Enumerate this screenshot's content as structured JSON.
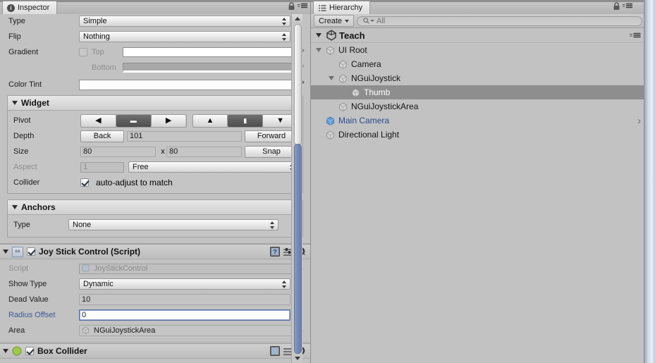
{
  "inspector": {
    "tab_label": "Inspector",
    "tab_icon": "info-icon",
    "lock_icon": "lock-icon",
    "menu_icon": "hamburger-menu-icon",
    "sprite_rows": [
      {
        "label": "Type",
        "value": "Simple",
        "kind": "popup"
      },
      {
        "label": "Flip",
        "value": "Nothing",
        "kind": "popup"
      }
    ],
    "gradient": {
      "label": "Gradient",
      "top_label": "Top",
      "bottom_label": "Bottom",
      "checked": false,
      "top_color": "#ffffff",
      "bottom_color": "#a8a8a8",
      "eyedropper_icon": "eyedropper-icon"
    },
    "color_tint": {
      "label": "Color Tint",
      "color": "#ffffff"
    },
    "widget": {
      "title": "Widget",
      "expanded": true,
      "pivot": {
        "label": "Pivot",
        "h_buttons": [
          "◀",
          "▬",
          "▶"
        ],
        "h_selected": 1,
        "v_buttons": [
          "▲",
          "▮",
          "▼"
        ],
        "v_selected": 1
      },
      "depth": {
        "label": "Depth",
        "back": "Back",
        "value": "101",
        "forward": "Forward"
      },
      "size": {
        "label": "Size",
        "width": "80",
        "sep": "x",
        "height": "80",
        "snap": "Snap"
      },
      "aspect": {
        "label": "Aspect",
        "value": "1",
        "mode": "Free",
        "disabled": true
      },
      "collider": {
        "label": "Collider",
        "checked": true,
        "text": "auto-adjust to match"
      }
    },
    "anchors": {
      "title": "Anchors",
      "expanded": true,
      "type": {
        "label": "Type",
        "value": "None"
      }
    },
    "joystick": {
      "title": "Joy Stick Control (Script)",
      "enabled": true,
      "expanded": true,
      "icon": "script-icon",
      "help_icon": "help-icon",
      "preset_icon": "preset-icon",
      "gear_icon": "gear-icon",
      "rows": [
        {
          "label": "Script",
          "value": "JoyStickControl",
          "kind": "object",
          "disabled": true,
          "icon": "script-ref-icon"
        },
        {
          "label": "Show Type",
          "value": "Dynamic",
          "kind": "popup"
        },
        {
          "label": "Dead Value",
          "value": "10",
          "kind": "text"
        },
        {
          "label": "Radius Offset",
          "value": "0",
          "kind": "text",
          "focused": true,
          "label_blue": true
        },
        {
          "label": "Area",
          "value": "NGuiJoystickArea",
          "kind": "object",
          "icon": "gameobject-icon"
        }
      ]
    },
    "next_component": {
      "title": "Box Collider",
      "checked": true,
      "icon": "collider-icon"
    }
  },
  "hierarchy": {
    "tab_label": "Hierarchy",
    "tab_icon": "hierarchy-icon",
    "lock_icon": "lock-icon",
    "menu_icon": "hamburger-menu-icon",
    "toolbar": {
      "create_label": "Create",
      "create_dropdown_icon": "chevron-down-icon",
      "search_icon": "search-icon",
      "search_value": "All",
      "search_placeholder": "All"
    },
    "scene_row": {
      "label": "Teach",
      "icon": "unity-scene-icon",
      "expanded": true,
      "menu_icon": "scene-menu-icon"
    },
    "items": [
      {
        "label": "UI Root",
        "depth": 1,
        "expanded": true,
        "icon": "gameobject-icon",
        "selected": false,
        "blue": false
      },
      {
        "label": "Camera",
        "depth": 2,
        "expanded": null,
        "icon": "gameobject-icon",
        "selected": false,
        "blue": false
      },
      {
        "label": "NGuiJoystick",
        "depth": 2,
        "expanded": true,
        "icon": "gameobject-icon",
        "selected": false,
        "blue": false
      },
      {
        "label": "Thumb",
        "depth": 3,
        "expanded": null,
        "icon": "gameobject-icon",
        "selected": true,
        "blue": false
      },
      {
        "label": "NGuiJoystickArea",
        "depth": 2,
        "expanded": null,
        "icon": "gameobject-icon",
        "selected": false,
        "blue": false
      },
      {
        "label": "Main Camera",
        "depth": 1,
        "expanded": null,
        "icon": "prefab-gameobject-icon",
        "selected": false,
        "blue": true,
        "chevron": "›"
      },
      {
        "label": "Directional Light",
        "depth": 1,
        "expanded": null,
        "icon": "gameobject-icon",
        "selected": false,
        "blue": false
      }
    ]
  },
  "colors": {
    "panel_bg": "#c2c2c2",
    "selection": "#8e8e8e",
    "link_blue": "#2d4b8e",
    "focus_blue": "#5a6fa8",
    "scroll_blue": "#7488b4"
  }
}
